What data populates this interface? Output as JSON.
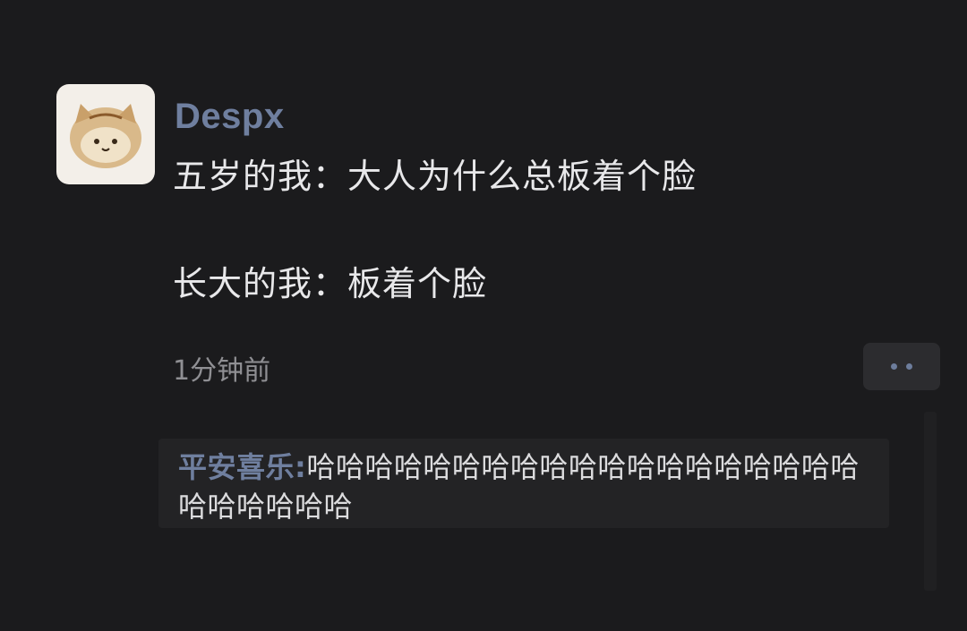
{
  "post": {
    "username": "Despx",
    "lines": [
      "五岁的我：大人为什么总板着个脸",
      "长大的我：板着个脸"
    ],
    "timestamp": "1分钟前"
  },
  "comment": {
    "author": "平安喜乐",
    "separator": ":",
    "text": "哈哈哈哈哈哈哈哈哈哈哈哈哈哈哈哈哈哈哈哈哈哈哈哈哈"
  },
  "icons": {
    "avatar": "cat-bread-avatar-icon",
    "more": "more-dots-icon"
  },
  "colors": {
    "background": "#1b1b1d",
    "accent": "#6f7f9f",
    "text": "#e8e8ea",
    "muted": "#8f8f93",
    "comment_bg": "#232325"
  }
}
